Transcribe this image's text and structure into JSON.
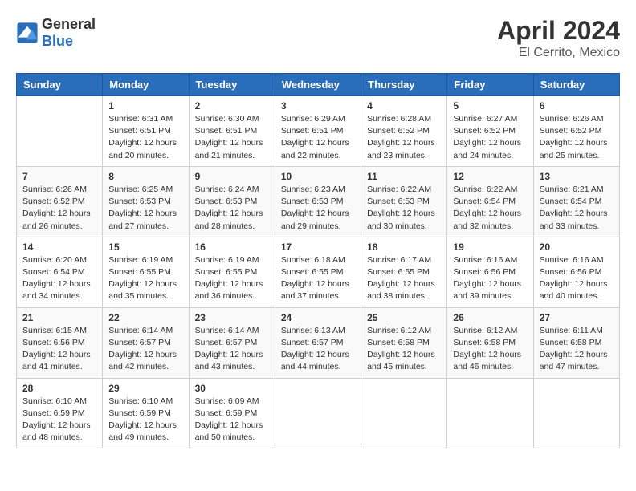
{
  "logo": {
    "general": "General",
    "blue": "Blue"
  },
  "title": "April 2024",
  "subtitle": "El Cerrito, Mexico",
  "days_of_week": [
    "Sunday",
    "Monday",
    "Tuesday",
    "Wednesday",
    "Thursday",
    "Friday",
    "Saturday"
  ],
  "weeks": [
    [
      {
        "day": "",
        "info": ""
      },
      {
        "day": "1",
        "info": "Sunrise: 6:31 AM\nSunset: 6:51 PM\nDaylight: 12 hours and 20 minutes."
      },
      {
        "day": "2",
        "info": "Sunrise: 6:30 AM\nSunset: 6:51 PM\nDaylight: 12 hours and 21 minutes."
      },
      {
        "day": "3",
        "info": "Sunrise: 6:29 AM\nSunset: 6:51 PM\nDaylight: 12 hours and 22 minutes."
      },
      {
        "day": "4",
        "info": "Sunrise: 6:28 AM\nSunset: 6:52 PM\nDaylight: 12 hours and 23 minutes."
      },
      {
        "day": "5",
        "info": "Sunrise: 6:27 AM\nSunset: 6:52 PM\nDaylight: 12 hours and 24 minutes."
      },
      {
        "day": "6",
        "info": "Sunrise: 6:26 AM\nSunset: 6:52 PM\nDaylight: 12 hours and 25 minutes."
      }
    ],
    [
      {
        "day": "7",
        "info": "Sunrise: 6:26 AM\nSunset: 6:52 PM\nDaylight: 12 hours and 26 minutes."
      },
      {
        "day": "8",
        "info": "Sunrise: 6:25 AM\nSunset: 6:53 PM\nDaylight: 12 hours and 27 minutes."
      },
      {
        "day": "9",
        "info": "Sunrise: 6:24 AM\nSunset: 6:53 PM\nDaylight: 12 hours and 28 minutes."
      },
      {
        "day": "10",
        "info": "Sunrise: 6:23 AM\nSunset: 6:53 PM\nDaylight: 12 hours and 29 minutes."
      },
      {
        "day": "11",
        "info": "Sunrise: 6:22 AM\nSunset: 6:53 PM\nDaylight: 12 hours and 30 minutes."
      },
      {
        "day": "12",
        "info": "Sunrise: 6:22 AM\nSunset: 6:54 PM\nDaylight: 12 hours and 32 minutes."
      },
      {
        "day": "13",
        "info": "Sunrise: 6:21 AM\nSunset: 6:54 PM\nDaylight: 12 hours and 33 minutes."
      }
    ],
    [
      {
        "day": "14",
        "info": "Sunrise: 6:20 AM\nSunset: 6:54 PM\nDaylight: 12 hours and 34 minutes."
      },
      {
        "day": "15",
        "info": "Sunrise: 6:19 AM\nSunset: 6:55 PM\nDaylight: 12 hours and 35 minutes."
      },
      {
        "day": "16",
        "info": "Sunrise: 6:19 AM\nSunset: 6:55 PM\nDaylight: 12 hours and 36 minutes."
      },
      {
        "day": "17",
        "info": "Sunrise: 6:18 AM\nSunset: 6:55 PM\nDaylight: 12 hours and 37 minutes."
      },
      {
        "day": "18",
        "info": "Sunrise: 6:17 AM\nSunset: 6:55 PM\nDaylight: 12 hours and 38 minutes."
      },
      {
        "day": "19",
        "info": "Sunrise: 6:16 AM\nSunset: 6:56 PM\nDaylight: 12 hours and 39 minutes."
      },
      {
        "day": "20",
        "info": "Sunrise: 6:16 AM\nSunset: 6:56 PM\nDaylight: 12 hours and 40 minutes."
      }
    ],
    [
      {
        "day": "21",
        "info": "Sunrise: 6:15 AM\nSunset: 6:56 PM\nDaylight: 12 hours and 41 minutes."
      },
      {
        "day": "22",
        "info": "Sunrise: 6:14 AM\nSunset: 6:57 PM\nDaylight: 12 hours and 42 minutes."
      },
      {
        "day": "23",
        "info": "Sunrise: 6:14 AM\nSunset: 6:57 PM\nDaylight: 12 hours and 43 minutes."
      },
      {
        "day": "24",
        "info": "Sunrise: 6:13 AM\nSunset: 6:57 PM\nDaylight: 12 hours and 44 minutes."
      },
      {
        "day": "25",
        "info": "Sunrise: 6:12 AM\nSunset: 6:58 PM\nDaylight: 12 hours and 45 minutes."
      },
      {
        "day": "26",
        "info": "Sunrise: 6:12 AM\nSunset: 6:58 PM\nDaylight: 12 hours and 46 minutes."
      },
      {
        "day": "27",
        "info": "Sunrise: 6:11 AM\nSunset: 6:58 PM\nDaylight: 12 hours and 47 minutes."
      }
    ],
    [
      {
        "day": "28",
        "info": "Sunrise: 6:10 AM\nSunset: 6:59 PM\nDaylight: 12 hours and 48 minutes."
      },
      {
        "day": "29",
        "info": "Sunrise: 6:10 AM\nSunset: 6:59 PM\nDaylight: 12 hours and 49 minutes."
      },
      {
        "day": "30",
        "info": "Sunrise: 6:09 AM\nSunset: 6:59 PM\nDaylight: 12 hours and 50 minutes."
      },
      {
        "day": "",
        "info": ""
      },
      {
        "day": "",
        "info": ""
      },
      {
        "day": "",
        "info": ""
      },
      {
        "day": "",
        "info": ""
      }
    ]
  ]
}
